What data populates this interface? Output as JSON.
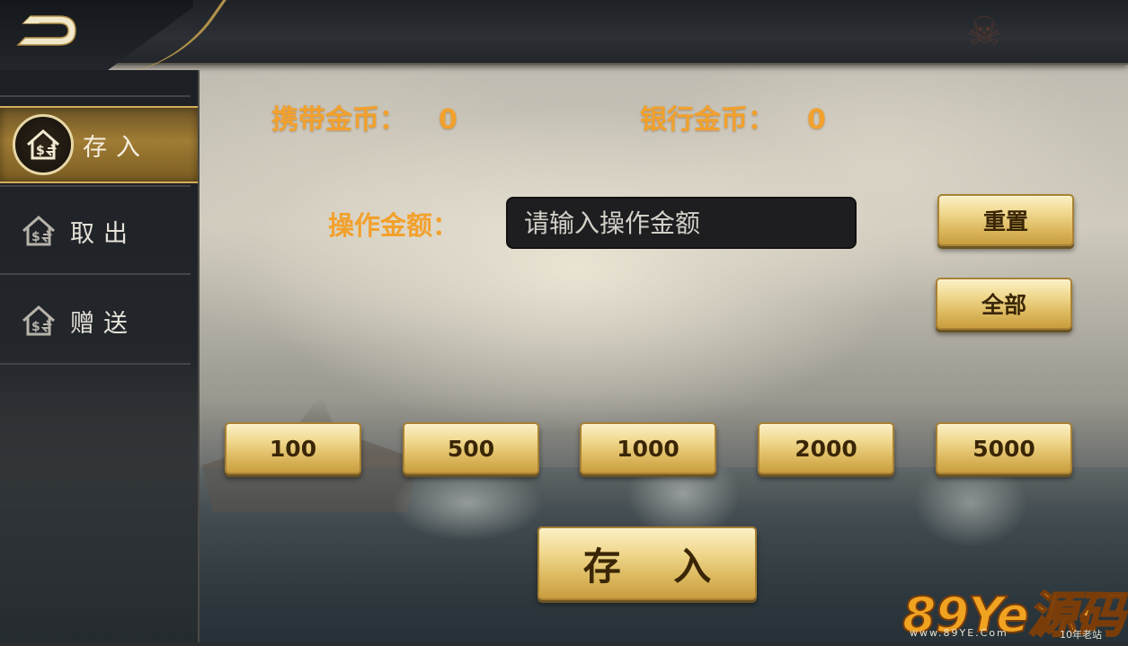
{
  "colors": {
    "accent": "#f2a12d",
    "gold_button": "#e8c670",
    "sidebar_active": "#a07c34"
  },
  "topbar": {
    "back_icon": "back-arrow-icon",
    "decoration_icon": "skull-crossbones-icon"
  },
  "sidebar": {
    "items": [
      {
        "label": "存入",
        "icon": "house-coin-icon",
        "active": true
      },
      {
        "label": "取出",
        "icon": "house-coin-icon",
        "active": false
      },
      {
        "label": "赠送",
        "icon": "house-coin-icon",
        "active": false
      }
    ]
  },
  "balances": {
    "carry_label": "携带金币：",
    "carry_value": "0",
    "bank_label": "银行金币：",
    "bank_value": "0"
  },
  "amount": {
    "label": "操作金额：",
    "placeholder": "请输入操作金额",
    "value": ""
  },
  "buttons": {
    "reset": "重置",
    "all": "全部",
    "presets": [
      "100",
      "500",
      "1000",
      "2000",
      "5000"
    ],
    "submit": "存 入"
  },
  "watermark": {
    "brand": "89Ye源码",
    "url": "www.89YE.Com",
    "tag": "10年老站"
  }
}
